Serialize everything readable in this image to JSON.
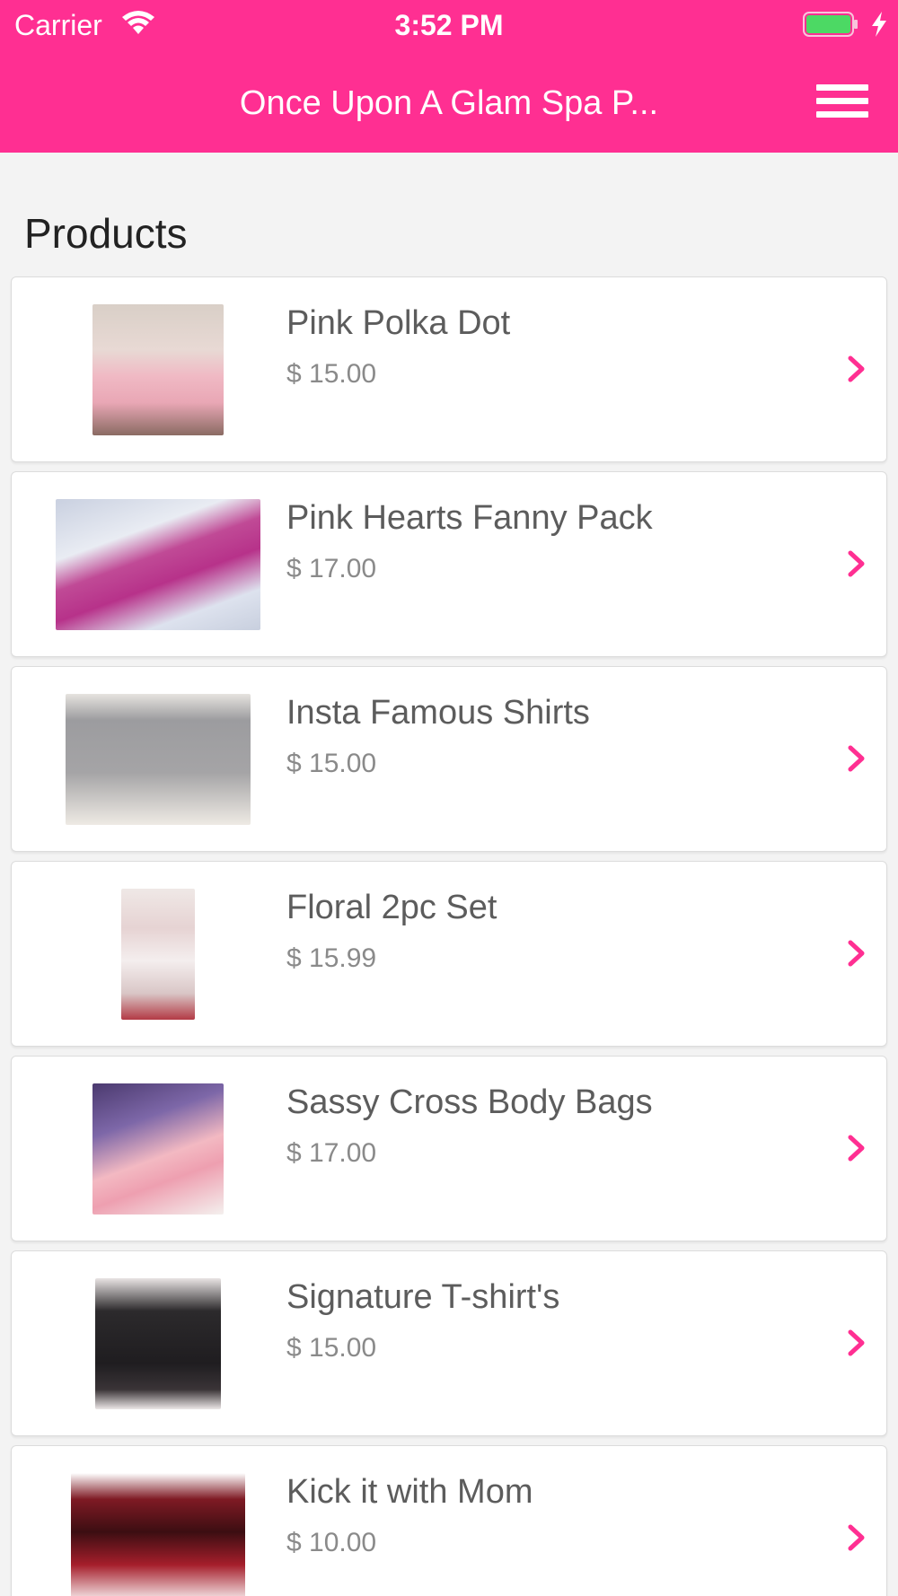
{
  "status_bar": {
    "carrier": "Carrier",
    "time": "3:52 PM"
  },
  "nav": {
    "title": "Once Upon A Glam Spa P...",
    "menu_icon": "hamburger-menu-icon"
  },
  "section": {
    "title": "Products"
  },
  "colors": {
    "brand": "#ff2f92",
    "background": "#f3f3f3",
    "card": "#ffffff",
    "chevron": "#ff2f92",
    "battery_fill": "#4cd964"
  },
  "products": [
    {
      "name": "Pink Polka Dot",
      "price": "$ 15.00"
    },
    {
      "name": "Pink Hearts Fanny Pack",
      "price": "$ 17.00"
    },
    {
      "name": "Insta Famous Shirts",
      "price": "$ 15.00"
    },
    {
      "name": "Floral 2pc Set",
      "price": "$ 15.99"
    },
    {
      "name": "Sassy Cross Body Bags",
      "price": "$ 17.00"
    },
    {
      "name": "Signature T-shirt's",
      "price": "$ 15.00"
    },
    {
      "name": "Kick it with Mom",
      "price": "$ 10.00"
    }
  ]
}
